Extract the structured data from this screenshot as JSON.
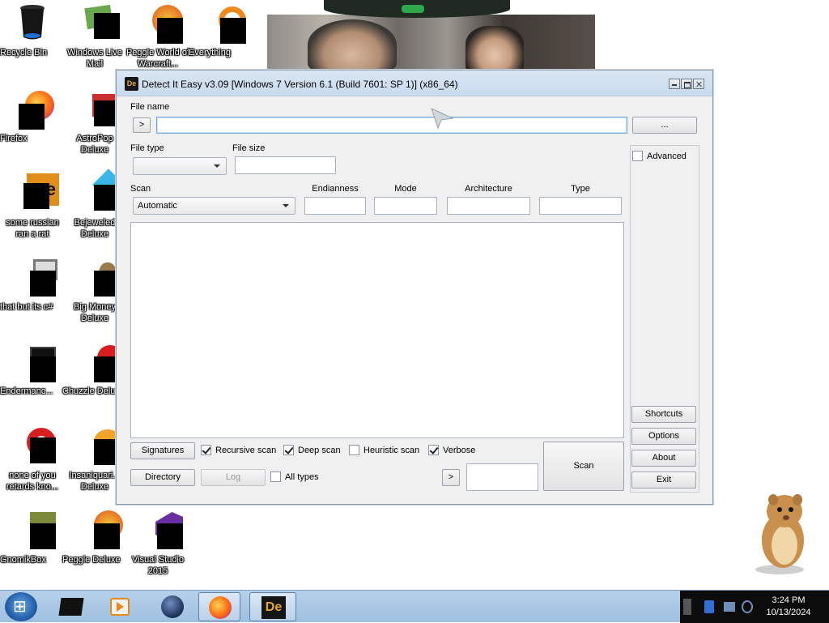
{
  "desktop": {
    "icons": [
      {
        "label": "Recycle Bin"
      },
      {
        "label": "Windows Live Mail"
      },
      {
        "label": "Peggle World of Warcraft..."
      },
      {
        "label": "Everything"
      },
      {
        "label": "Firefox"
      },
      {
        "label": "AstroPop Deluxe"
      },
      {
        "label": "some russian ran a rat"
      },
      {
        "label": "Bejeweled Deluxe"
      },
      {
        "label": "that but its c#"
      },
      {
        "label": "Big Money Deluxe"
      },
      {
        "label": "Endermanc..."
      },
      {
        "label": "Chuzzle Deluxe"
      },
      {
        "label": "none of you retards kno..."
      },
      {
        "label": "Insaniquari... Deluxe"
      },
      {
        "label": "GnomikBox"
      },
      {
        "label": "Peggle Deluxe"
      },
      {
        "label": "Visual Studio 2015"
      }
    ]
  },
  "window": {
    "logo_text": "De",
    "title": "Detect It Easy v3.09 [Windows 7 Version 6.1 (Build 7601: SP 1)] (x86_64)",
    "file_name_label": "File name",
    "file_name_value": "",
    "go_button": ">",
    "browse_button": "...",
    "file_type_label": "File type",
    "file_type_value": "",
    "file_size_label": "File size",
    "file_size_value": "",
    "advanced_label": "Advanced",
    "scan_label": "Scan",
    "scan_value": "Automatic",
    "endianness_label": "Endianness",
    "endianness_value": "",
    "mode_label": "Mode",
    "mode_value": "",
    "architecture_label": "Architecture",
    "architecture_value": "",
    "type_label": "Type",
    "type_value": "",
    "signatures_button": "Signatures",
    "recursive_scan": {
      "label": "Recursive scan",
      "checked": true
    },
    "deep_scan": {
      "label": "Deep scan",
      "checked": true
    },
    "heuristic_scan": {
      "label": "Heuristic scan",
      "checked": false
    },
    "verbose": {
      "label": "Verbose",
      "checked": true
    },
    "directory_button": "Directory",
    "log_button": "Log",
    "all_types": {
      "label": "All types",
      "checked": false
    },
    "arrow_button": ">",
    "scan_button": "Scan",
    "shortcuts_button": "Shortcuts",
    "options_button": "Options",
    "about_button": "About",
    "exit_button": "Exit"
  },
  "taskbar": {
    "clock_time": "3:24 PM",
    "clock_date": "10/13/2024",
    "pinned": [
      "console-icon",
      "media-player-icon",
      "globe-icon",
      "firefox-icon",
      "detect-it-easy-icon"
    ]
  }
}
